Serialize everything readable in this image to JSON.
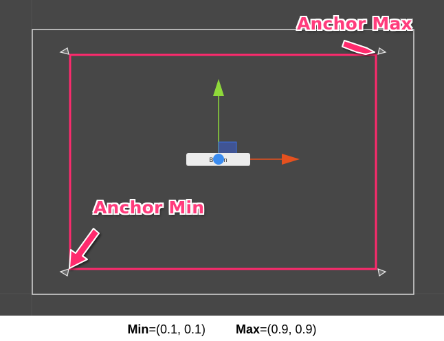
{
  "callouts": {
    "anchor_max": "Anchor Max",
    "anchor_min": "Anchor Min"
  },
  "button": {
    "label": "Button"
  },
  "caption": {
    "min_label": "Min",
    "min_value": "=(0.1, 0.1)",
    "max_label": "Max",
    "max_value": "=(0.9, 0.9)"
  },
  "colors": {
    "scene_background": "#474747",
    "rect_outline": "#ff2a6d",
    "canvas_border": "#d8d8d8",
    "x_axis": "#e5511f",
    "y_axis": "#8fd93a",
    "pivot": "#3b8cf0"
  },
  "icons": [
    "anchor-handle-icon",
    "move-x-arrow-icon",
    "move-y-arrow-icon",
    "pivot-icon",
    "callout-arrow-icon"
  ]
}
